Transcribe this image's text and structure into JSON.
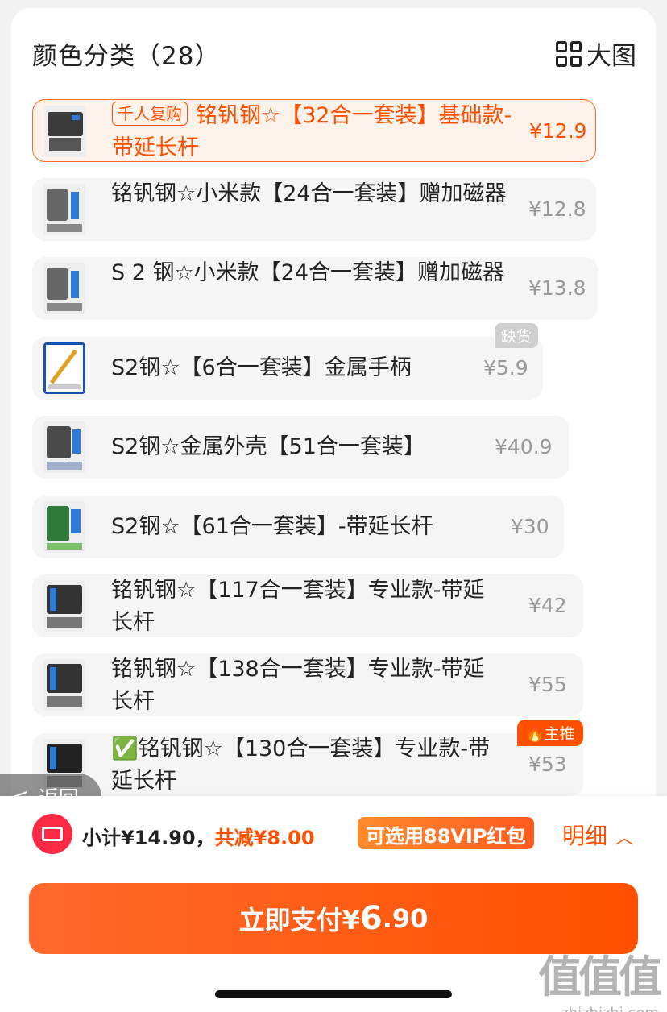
{
  "header": {
    "title": "颜色分类（28）",
    "big_view_label": "大图"
  },
  "options": [
    {
      "name": "铭钒钢☆【32合一套装】基础款-带延长杆",
      "tag": "千人复购",
      "price": "¥12.9",
      "selected": true
    },
    {
      "name": "铭钒钢☆小米款【24合一套装】赠加磁器",
      "price": "¥12.8"
    },
    {
      "name": "S 2 钢☆小米款【24合一套装】赠加磁器",
      "price": "¥13.8"
    },
    {
      "name": "S2钢☆【6合一套装】金属手柄",
      "price": "¥5.9",
      "badge": "缺货"
    },
    {
      "name": "S2钢☆金属外壳【51合一套装】",
      "price": "¥40.9"
    },
    {
      "name": "S2钢☆【61合一套装】-带延长杆",
      "price": "¥30"
    },
    {
      "name": "铭钒钢☆【117合一套装】专业款-带延长杆",
      "price": "¥42"
    },
    {
      "name": "铭钒钢☆【138合一套装】专业款-带延长杆",
      "price": "¥55"
    },
    {
      "name": "✅铭钒钢☆【130合一套装】专业款-带延长杆",
      "price": "¥53",
      "badge": "主推"
    }
  ],
  "back_button": {
    "label": "返回"
  },
  "footer": {
    "subtotal": "小计¥14.90，",
    "reduction": "共减¥8.00",
    "vip_label": "可选用88VIP红包",
    "detail_label": "明细",
    "pay_prefix": "立即支付¥",
    "pay_int": "6",
    "pay_dec": ".90"
  },
  "watermark": {
    "logo": "值值值",
    "url": "zhizhizhi.com"
  },
  "colors": {
    "accent": "#ff5000",
    "selected_bg": "#fff2ea",
    "item_bg": "#f5f5f5"
  }
}
